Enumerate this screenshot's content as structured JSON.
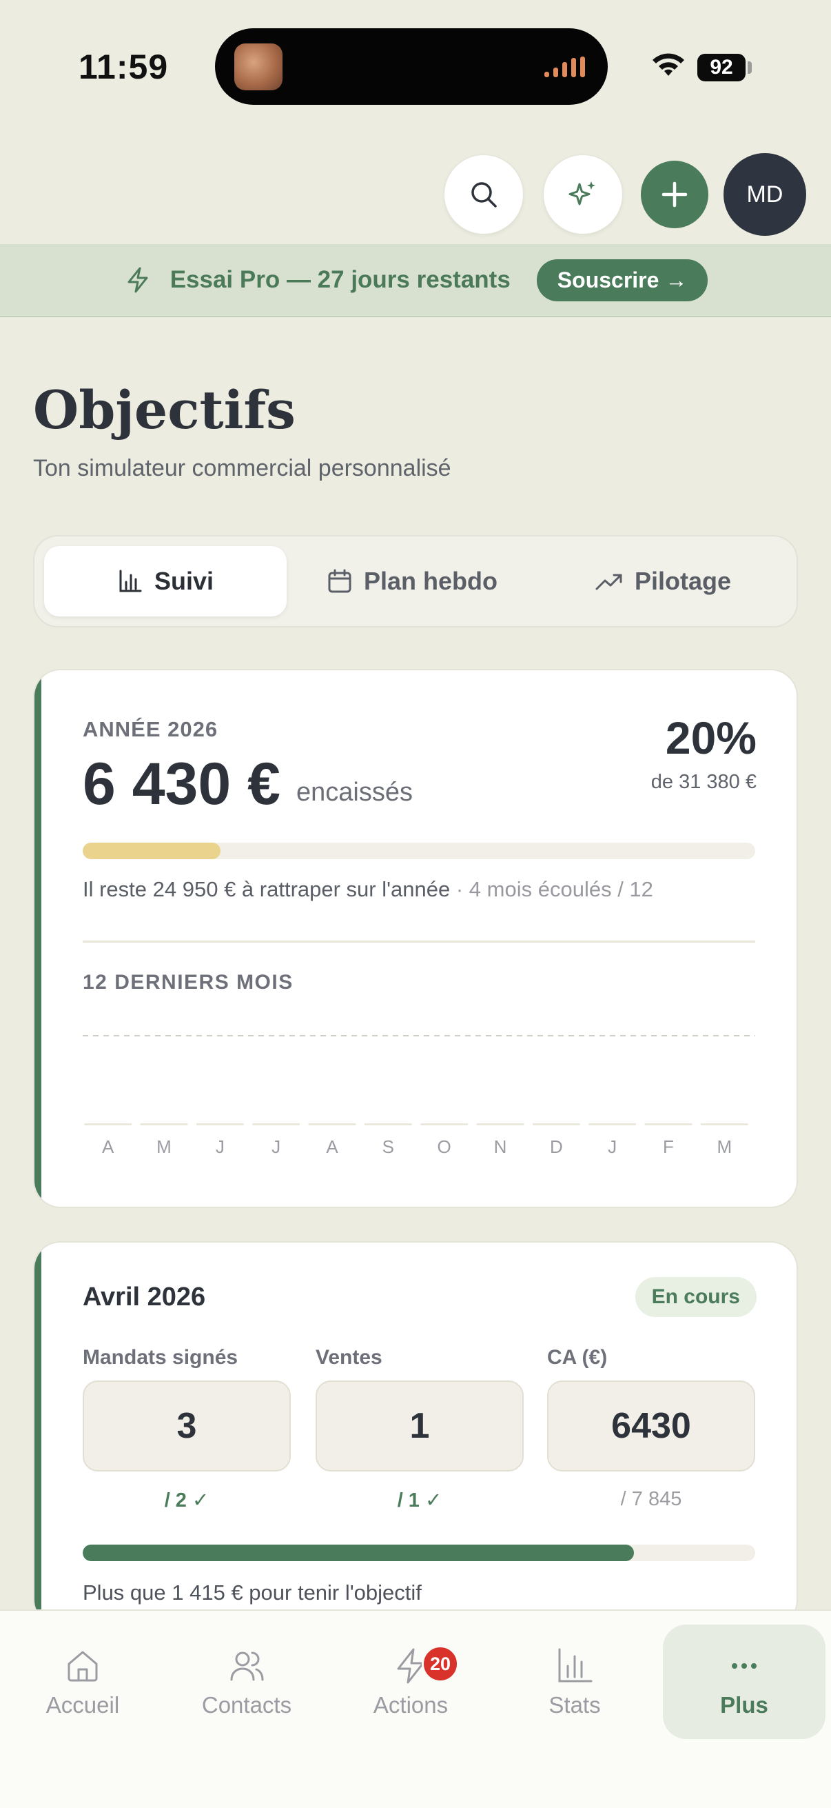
{
  "status_bar": {
    "time": "11:59",
    "battery": "92"
  },
  "header": {
    "search_icon": "search-icon",
    "ai_icon": "sparkles-icon",
    "add_icon": "plus-icon",
    "avatar_initials": "MD"
  },
  "banner": {
    "icon": "lightning-icon",
    "text": "Essai Pro — 27 jours restants",
    "cta": "Souscrire →"
  },
  "page": {
    "title": "Objectifs",
    "subtitle": "Ton simulateur commercial personnalisé"
  },
  "tabs": [
    {
      "label": "Suivi",
      "icon": "bar-chart-icon",
      "active": true
    },
    {
      "label": "Plan hebdo",
      "icon": "calendar-icon",
      "active": false
    },
    {
      "label": "Pilotage",
      "icon": "trend-up-icon",
      "active": false
    }
  ],
  "year_card": {
    "label": "ANNÉE 2026",
    "amount": "6 430 €",
    "amount_suffix": "encaissés",
    "percent": "20%",
    "of_target": "de 31 380 €",
    "progress_fraction": 0.205,
    "remaining_text": "Il reste 24 950 € à rattraper sur l'année",
    "months_elapsed": "· 4 mois écoulés / 12",
    "chart_title": "12 DERNIERS MOIS",
    "colors": {
      "accent": "#4a7b5a",
      "progress": "#ead38d"
    }
  },
  "chart_data": {
    "type": "bar",
    "title": "12 DERNIERS MOIS",
    "categories": [
      "A",
      "M",
      "J",
      "J",
      "A",
      "S",
      "O",
      "N",
      "D",
      "J",
      "F",
      "M"
    ],
    "values": [
      0,
      0,
      0,
      0,
      0,
      0,
      0,
      0,
      0,
      0,
      0,
      0
    ],
    "target_line": "dashed",
    "grid": false
  },
  "month_card": {
    "title": "Avril 2026",
    "status": "En cours",
    "metrics": [
      {
        "label": "Mandats signés",
        "value": "3",
        "target": "/ 2",
        "reached": true
      },
      {
        "label": "Ventes",
        "value": "1",
        "target": "/ 1",
        "reached": true
      },
      {
        "label": "CA (€)",
        "value": "6430",
        "target": "/ 7 845",
        "reached": false
      }
    ],
    "progress_fraction": 0.82,
    "note": "Plus que 1 415 € pour tenir l'objectif"
  },
  "bottom_nav": [
    {
      "label": "Accueil",
      "icon": "home-icon",
      "active": false
    },
    {
      "label": "Contacts",
      "icon": "users-icon",
      "active": false
    },
    {
      "label": "Actions",
      "icon": "lightning-icon",
      "badge": "20",
      "active": false
    },
    {
      "label": "Stats",
      "icon": "bar-chart-icon",
      "active": false
    },
    {
      "label": "Plus",
      "icon": "more-icon",
      "active": true
    }
  ]
}
